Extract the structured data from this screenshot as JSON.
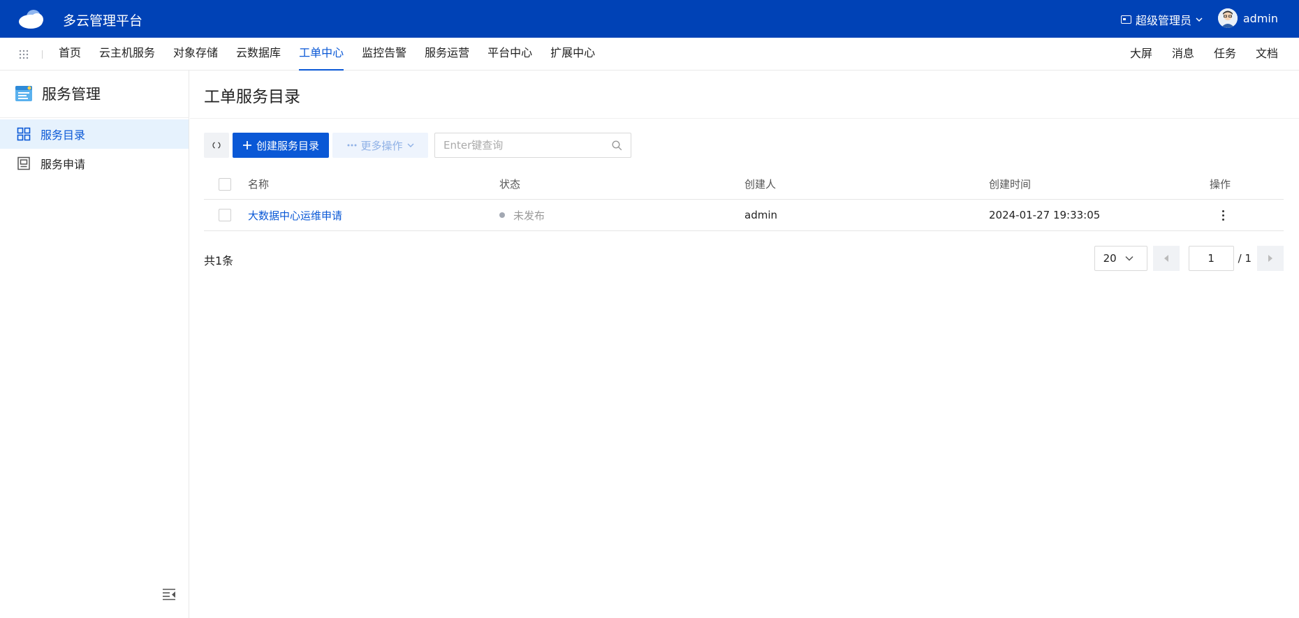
{
  "header": {
    "app_title": "多云管理平台",
    "role_label": "超级管理员",
    "username": "admin"
  },
  "nav": {
    "items": [
      {
        "label": "首页"
      },
      {
        "label": "云主机服务"
      },
      {
        "label": "对象存储"
      },
      {
        "label": "云数据库"
      },
      {
        "label": "工单中心"
      },
      {
        "label": "监控告警"
      },
      {
        "label": "服务运营"
      },
      {
        "label": "平台中心"
      },
      {
        "label": "扩展中心"
      }
    ],
    "active": "工单中心",
    "right_items": [
      {
        "label": "大屏"
      },
      {
        "label": "消息"
      },
      {
        "label": "任务"
      },
      {
        "label": "文档"
      }
    ]
  },
  "sidebar": {
    "title": "服务管理",
    "items": [
      {
        "label": "服务目录",
        "active": true
      },
      {
        "label": "服务申请",
        "active": false
      }
    ]
  },
  "main": {
    "page_title": "工单服务目录",
    "toolbar": {
      "create_label": "创建服务目录",
      "more_label": "更多操作",
      "search_placeholder": "Enter键查询"
    },
    "table": {
      "columns": [
        "名称",
        "状态",
        "创建人",
        "创建时间",
        "操作"
      ],
      "rows": [
        {
          "name": "大数据中心运维申请",
          "status": "未发布",
          "creator": "admin",
          "created_at": "2024-01-27 19:33:05"
        }
      ]
    },
    "footer": {
      "total": "共1条",
      "page_size": "20",
      "current_page": "1",
      "total_pages": "/ 1"
    }
  },
  "colors": {
    "header_bg": "#0042b6",
    "accent": "#0a58d6",
    "active_side_bg": "#e6f2fd"
  }
}
